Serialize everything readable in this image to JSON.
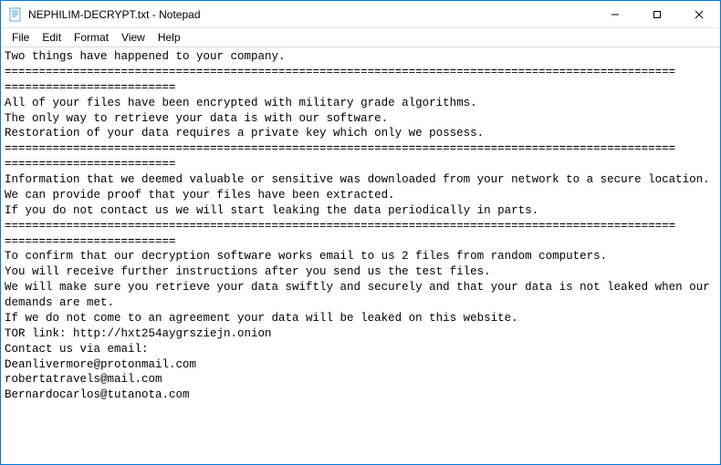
{
  "window": {
    "title": "NEPHILIM-DECRYPT.txt - Notepad",
    "app_icon": "notepad-icon"
  },
  "menu": {
    "items": [
      "File",
      "Edit",
      "Format",
      "View",
      "Help"
    ]
  },
  "controls": {
    "minimize": "—",
    "maximize": "☐",
    "close": "✕"
  },
  "document": {
    "lines": [
      "Two things have happened to your company.",
      "==================================================================================================",
      "=========================",
      "All of your files have been encrypted with military grade algorithms.",
      "The only way to retrieve your data is with our software.",
      "Restoration of your data requires a private key which only we possess.",
      "==================================================================================================",
      "=========================",
      "Information that we deemed valuable or sensitive was downloaded from your network to a secure location.",
      "We can provide proof that your files have been extracted.",
      "If you do not contact us we will start leaking the data periodically in parts.",
      "==================================================================================================",
      "=========================",
      "To confirm that our decryption software works email to us 2 files from random computers.",
      "You will receive further instructions after you send us the test files.",
      "We will make sure you retrieve your data swiftly and securely and that your data is not leaked when our demands are met.",
      "If we do not come to an agreement your data will be leaked on this website.",
      "TOR link: http://hxt254aygrsziejn.onion",
      "",
      "Contact us via email:",
      "Deanlivermore@protonmail.com",
      "robertatravels@mail.com",
      "Bernardocarlos@tutanota.com"
    ]
  }
}
